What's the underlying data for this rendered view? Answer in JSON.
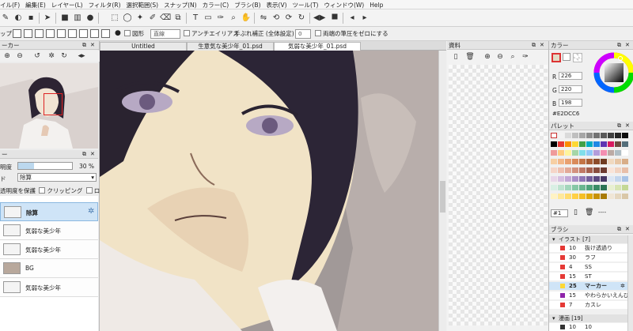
{
  "menu": {
    "items": [
      "イル(F)",
      "編集(E)",
      "レイヤー(L)",
      "フィルタ(R)",
      "選択範囲(S)",
      "スナップ(N)",
      "カラー(C)",
      "ブラシ(B)",
      "表示(V)",
      "ツール(T)",
      "ウィンドウ(W)",
      "Help"
    ]
  },
  "optionbar": {
    "snap_label": "ップ",
    "shape_label": "図形",
    "line_select": "直線",
    "antialias_label": "アンチエイリアス",
    "stabilizer_label": "手ぶれ補正 (全体設定)",
    "stabilizer_value": "0",
    "pressure_label": "両端の筆圧をゼロにする"
  },
  "navigator": {
    "title": "ーカー"
  },
  "layers_panel": {
    "title": "ー",
    "opacity_label": "明度",
    "opacity_value": "30 %",
    "blend_label": "ド",
    "blend_value": "除算",
    "protect_label": "透明度を保護",
    "clipping_label": "クリッピング",
    "lock_label": "ロック",
    "layers": [
      {
        "name": "除算",
        "selected": true
      },
      {
        "name": "気弱な美少年",
        "selected": false
      },
      {
        "name": "気弱な美少年",
        "selected": false
      },
      {
        "name": "BG",
        "selected": false
      },
      {
        "name": "気弱な美少年",
        "selected": false
      }
    ]
  },
  "tabs": [
    {
      "label": "Untitled",
      "active": false
    },
    {
      "label": "生意気な美少年_01.psd",
      "active": false
    },
    {
      "label": "気弱な美少年_01.psd",
      "active": true
    }
  ],
  "material": {
    "title": "資料"
  },
  "color_panel": {
    "title": "カラー",
    "r_label": "R",
    "r_value": "226",
    "g_label": "G",
    "g_value": "220",
    "b_label": "B",
    "b_value": "198",
    "hex": "#E2DCC6",
    "current_color": "#E2DCC6"
  },
  "palette": {
    "title": "パレット",
    "selector": "#1",
    "suffix": "----",
    "colors": [
      "#ffffff",
      "#f2f2f2",
      "#dadada",
      "#bfbfbf",
      "#a6a6a6",
      "#8c8c8c",
      "#737373",
      "#595959",
      "#404040",
      "#262626",
      "#0d0d0d",
      "#000000",
      "#e53935",
      "#fb8c00",
      "#fdd835",
      "#43a047",
      "#00acc1",
      "#1e88e5",
      "#5e35b1",
      "#d81b60",
      "#6d4c41",
      "#546e7a",
      "#ef9a9a",
      "#ffcc80",
      "#fff59d",
      "#a5d6a7",
      "#80deea",
      "#90caf9",
      "#b39ddb",
      "#f48fb1",
      "#bcaaa4",
      "#b0bec5",
      "#ffffff",
      "#f7cfa3",
      "#f3b88a",
      "#e9a070",
      "#d98a5a",
      "#c37446",
      "#a85f37",
      "#8c4c2b",
      "#6f3b21",
      "#f0d9c0",
      "#e7c6a5",
      "#d8ad88",
      "#f5d5c8",
      "#efc0b0",
      "#e3a997",
      "#d3917e",
      "#c07865",
      "#a5614f",
      "#884d3e",
      "#6c3b30",
      "#f9e4d8",
      "#f2d3c1",
      "#e8bea8",
      "#e8d6e8",
      "#d6bfe0",
      "#c3a8d6",
      "#aa8fc7",
      "#8f76b5",
      "#745f9c",
      "#5c4a80",
      "#463865",
      "#dbe6f4",
      "#c3d6ee",
      "#a8c3e6",
      "#d9efe4",
      "#bfe3d0",
      "#a3d6bb",
      "#86c7a5",
      "#6ab68f",
      "#4fa37a",
      "#3b8c66",
      "#2b7353",
      "#e8f0d0",
      "#d7e5b3",
      "#c4d895",
      "#fff3c4",
      "#ffe89a",
      "#ffdc6f",
      "#ffd045",
      "#f5bf25",
      "#e0aa0e",
      "#c79206",
      "#a87a04",
      "#f0e6d6",
      "#e5d7c0",
      "#d9c7a8"
    ]
  },
  "brush_panel": {
    "title": "ブラシ",
    "group_label": "イラスト [7]",
    "group2_label": "漫画 [19]",
    "brushes": [
      {
        "num": "10",
        "name": "抜け透過り",
        "color": "#e53935"
      },
      {
        "num": "30",
        "name": "ラフ",
        "color": "#e53935"
      },
      {
        "num": "4",
        "name": "SS",
        "color": "#e53935"
      },
      {
        "num": "15",
        "name": "ST",
        "color": "#e53935"
      },
      {
        "num": "25",
        "name": "マーカー",
        "color": "#fdd835"
      },
      {
        "num": "15",
        "name": "やわらかいえんぴつ",
        "color": "#8e24aa"
      },
      {
        "num": "7",
        "name": "カスレ",
        "color": "#e53935"
      },
      {
        "num": "10",
        "name": "10",
        "color": "#333333"
      }
    ]
  }
}
